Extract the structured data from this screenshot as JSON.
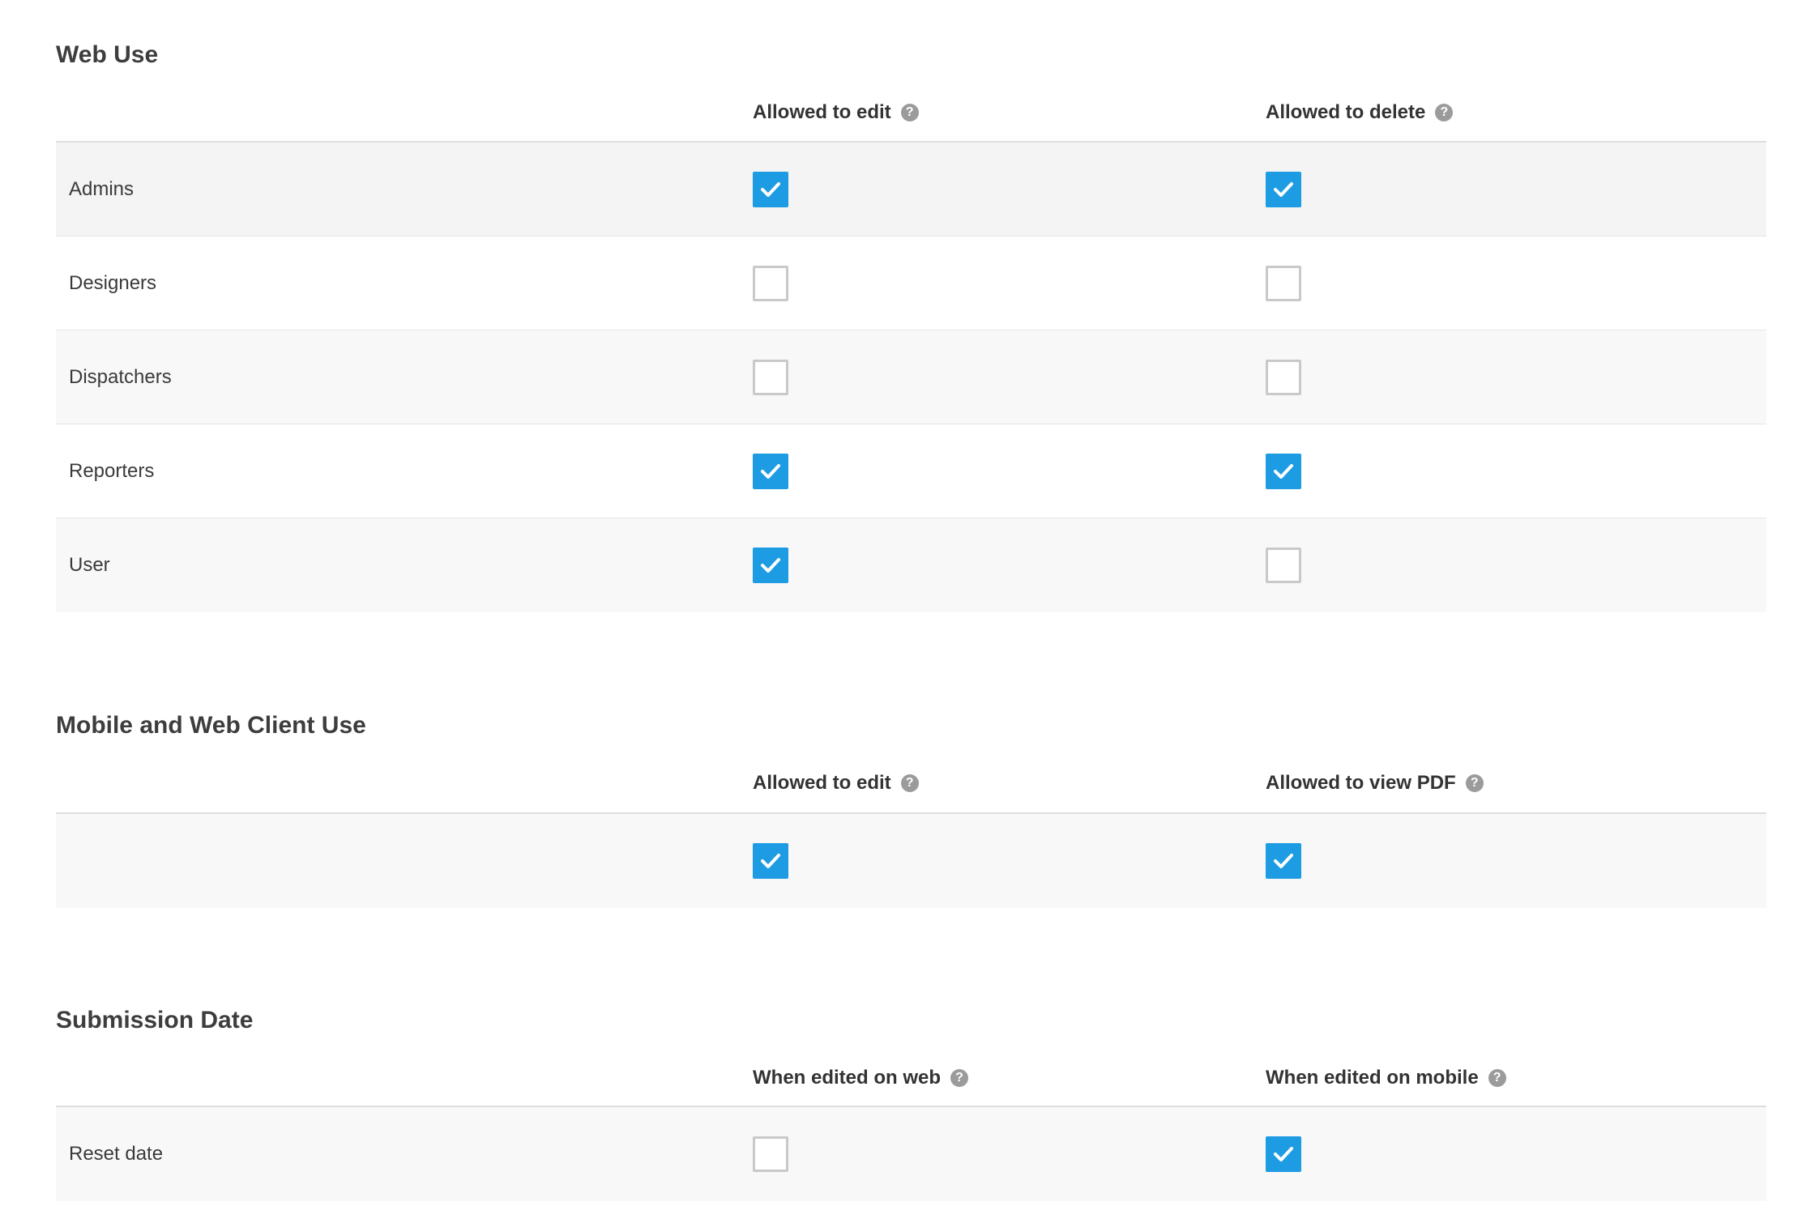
{
  "sections": [
    {
      "title": "Web Use",
      "columns": [
        "Allowed to edit",
        "Allowed to delete"
      ],
      "rows": [
        {
          "label": "Admins",
          "col1_checked": true,
          "col2_checked": true
        },
        {
          "label": "Designers",
          "col1_checked": false,
          "col2_checked": false
        },
        {
          "label": "Dispatchers",
          "col1_checked": false,
          "col2_checked": false
        },
        {
          "label": "Reporters",
          "col1_checked": true,
          "col2_checked": true
        },
        {
          "label": "User",
          "col1_checked": true,
          "col2_checked": false
        }
      ]
    },
    {
      "title": "Mobile and Web Client Use",
      "columns": [
        "Allowed to edit",
        "Allowed to view PDF"
      ],
      "rows": [
        {
          "label": "",
          "col1_checked": true,
          "col2_checked": true
        }
      ]
    },
    {
      "title": "Submission Date",
      "columns": [
        "When edited on web",
        "When edited on mobile"
      ],
      "rows": [
        {
          "label": "Reset date",
          "col1_checked": false,
          "col2_checked": true
        }
      ]
    }
  ],
  "colors": {
    "checkbox_checked": "#1e9ce3",
    "checkbox_unchecked_border": "#c9c9c9",
    "help_icon": "#9b9b9b"
  },
  "icons": {
    "help": "question-circle-icon",
    "check": "checkmark-icon"
  }
}
